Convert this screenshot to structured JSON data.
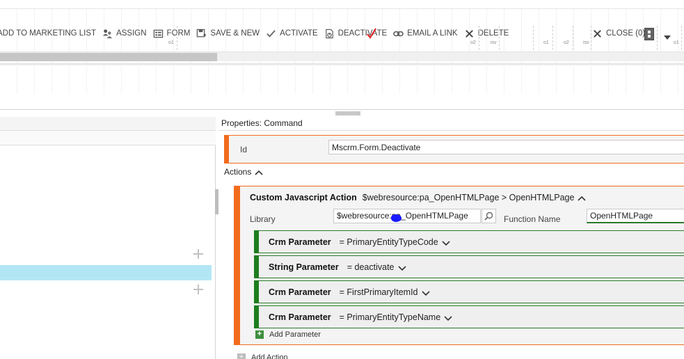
{
  "ribbon": {
    "buttons": [
      {
        "label": "ADD TO MARKETING LIST",
        "icon": "marketing-list-icon"
      },
      {
        "label": "ASSIGN",
        "icon": "assign-users-icon"
      },
      {
        "label": "FORM",
        "icon": "form-icon"
      },
      {
        "label": "SAVE & NEW",
        "icon": "save-new-icon"
      },
      {
        "label": "ACTIVATE",
        "icon": "checkmark-icon"
      },
      {
        "label": "DEACTIVATE",
        "icon": "deactivate-icon"
      },
      {
        "label": "EMAIL A LINK",
        "icon": "link-icon"
      },
      {
        "label": "DELETE",
        "icon": "delete-x-icon"
      },
      {
        "label": "CLOSE (0)",
        "icon": "close-x-icon"
      }
    ],
    "segment_labels": [
      "o1",
      "o2",
      "isv",
      "o1",
      "o2",
      "isv",
      "o1"
    ],
    "accent_check_color": "#e01b1b"
  },
  "properties": {
    "title": "Properties: Command",
    "id_label": "Id",
    "id_value": "Mscrm.Form.Deactivate"
  },
  "actions": {
    "header": "Actions",
    "action": {
      "type_label": "Custom Javascript Action",
      "path": "$webresource:pa_OpenHTMLPage > OpenHTMLPage",
      "library_label": "Library",
      "library_value_prefix": "$webresource:pa",
      "library_value_suffix": "_OpenHTMLPage",
      "function_label": "Function Name",
      "function_value": "OpenHTMLPage",
      "parameters": [
        {
          "type": "Crm Parameter",
          "value": "= PrimaryEntityTypeCode"
        },
        {
          "type": "String Parameter",
          "value": "= deactivate"
        },
        {
          "type": "Crm Parameter",
          "value": "= FirstPrimaryItemId"
        },
        {
          "type": "Crm Parameter",
          "value": "= PrimaryEntityTypeName"
        }
      ],
      "add_parameter_label": "Add Parameter"
    },
    "add_action_label": "Add Action"
  },
  "colors": {
    "action_border": "#f26b1d",
    "parameter_border": "#1e7d1e",
    "selected_row": "#b3e6f5"
  }
}
